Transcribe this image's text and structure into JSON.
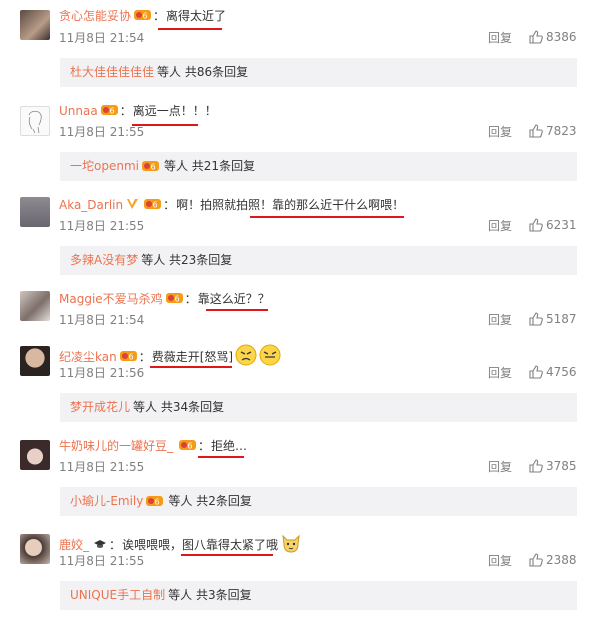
{
  "comments": [
    {
      "username": "贪心怎能妥协",
      "text": "离得太近了",
      "time": "11月8日 21:54",
      "reply_label": "回复",
      "likes": "8386",
      "sub": {
        "name": "杜大佳佳佳佳佳",
        "suffix": "等人 共86条回复"
      }
    },
    {
      "username": "Unnaa",
      "text": "离远一点！！！",
      "time": "11月8日 21:55",
      "reply_label": "回复",
      "likes": "7823",
      "sub": {
        "name": "一坨openmi",
        "suffix": "等人 共21条回复"
      }
    },
    {
      "username": "Aka_Darlin",
      "text": "啊！拍照就拍照！靠的那么近干什么啊喂！",
      "time": "11月8日 21:55",
      "reply_label": "回复",
      "likes": "6231",
      "sub": {
        "name": "多辣A没有梦",
        "suffix": "等人 共23条回复"
      }
    },
    {
      "username": "Maggie不爱马杀鸡",
      "text": "靠这么近？？",
      "time": "11月8日 21:54",
      "reply_label": "回复",
      "likes": "5187"
    },
    {
      "username": "纪凌尘kan",
      "text": "费薇走开[怒骂]",
      "time": "11月8日 21:56",
      "reply_label": "回复",
      "likes": "4756",
      "sub": {
        "name": "梦开成花儿",
        "suffix": "等人 共34条回复"
      }
    },
    {
      "username": "牛奶味儿的一罐好豆_",
      "text": "拒绝…",
      "time": "11月8日 21:55",
      "reply_label": "回复",
      "likes": "3785",
      "sub": {
        "name": "小瑜儿-Emily",
        "suffix": "等人 共2条回复"
      }
    },
    {
      "username": "鹿姣_",
      "text": "诶喂喂喂，图八靠得太紧了哦",
      "time": "11月8日 21:55",
      "reply_label": "回复",
      "likes": "2388",
      "sub": {
        "name": "UNIQUE手工自制",
        "suffix": "等人 共3条回复"
      }
    }
  ],
  "colors": {
    "username": "#eb7350",
    "meta": "#808080",
    "subbox_bg": "#f2f2f5",
    "underline": "#e0171a"
  }
}
